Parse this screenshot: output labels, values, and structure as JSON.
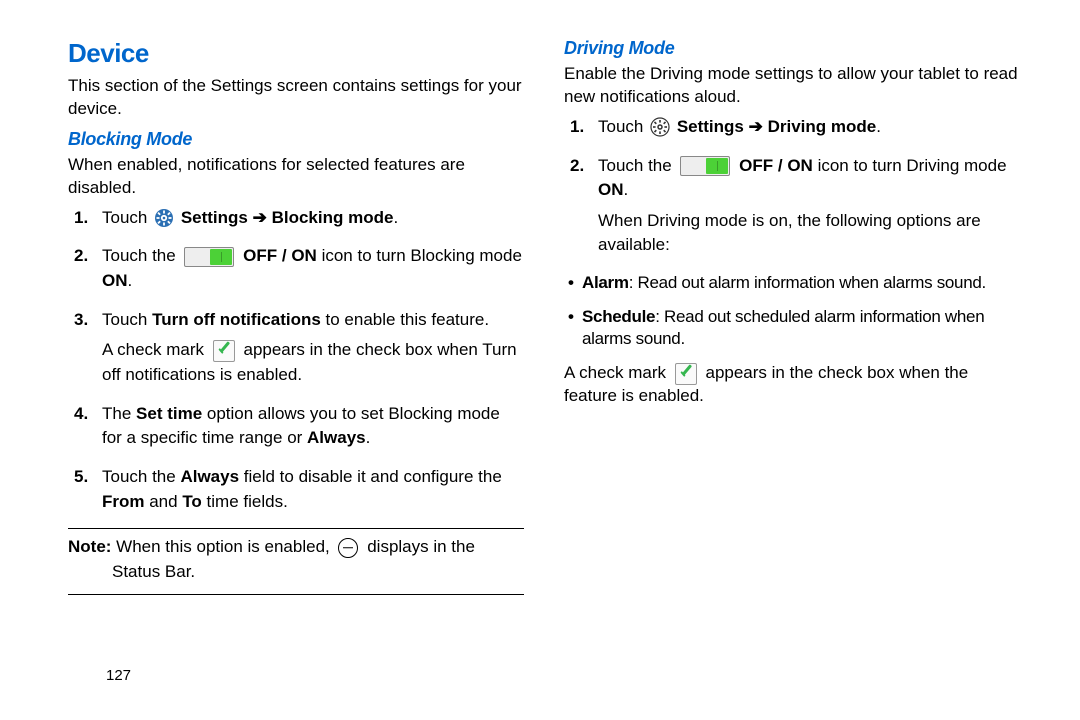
{
  "page_number": "127",
  "left": {
    "heading": "Device",
    "intro": "This section of the Settings screen contains settings for your device.",
    "section_title": "Blocking Mode",
    "section_desc": "When enabled, notifications for selected features are disabled.",
    "steps": {
      "s1_num": "1.",
      "s1_touch": "Touch ",
      "s1_settings": " Settings ",
      "s1_arrow": "➔",
      "s1_mode": " Blocking mode",
      "s1_period": ".",
      "s2_num": "2.",
      "s2_a": "Touch the ",
      "s2_offon": " OFF / ON",
      "s2_b": " icon to turn Blocking mode ",
      "s2_on": "ON",
      "s2_period": ".",
      "s3_num": "3.",
      "s3_a": "Touch ",
      "s3_b": "Turn off notifications",
      "s3_c": " to enable this feature.",
      "s3_sub_a": "A check mark ",
      "s3_sub_b": " appears in the check box when Turn off notifications is enabled.",
      "s4_num": "4.",
      "s4_a": "The ",
      "s4_b": "Set time",
      "s4_c": " option allows you to set Blocking mode for a specific time range or ",
      "s4_d": "Always",
      "s4_period": ".",
      "s5_num": "5.",
      "s5_a": "Touch the ",
      "s5_b": "Always",
      "s5_c": " field to disable it and configure the ",
      "s5_d": "From",
      "s5_e": " and ",
      "s5_f": "To",
      "s5_g": " time fields."
    },
    "note_label": "Note:",
    "note_a": " When this option is enabled, ",
    "note_b": " displays in the",
    "note_c": "Status Bar."
  },
  "right": {
    "section_title": "Driving Mode",
    "section_desc": "Enable the Driving mode settings to allow your tablet to read new notifications aloud.",
    "steps": {
      "s1_num": "1.",
      "s1_touch": "Touch ",
      "s1_settings": " Settings ",
      "s1_arrow": "➔",
      "s1_mode": " Driving mode",
      "s1_period": ".",
      "s2_num": "2.",
      "s2_a": "Touch the ",
      "s2_offon": " OFF / ON",
      "s2_b": " icon to turn Driving mode ",
      "s2_on": "ON",
      "s2_period": ".",
      "s2_sub": "When Driving mode is on, the following options are available:"
    },
    "bullets": {
      "b1_a": "Alarm",
      "b1_b": ": Read out alarm information when alarms sound.",
      "b2_a": "Schedule",
      "b2_b": ": Read out scheduled alarm information when alarms sound."
    },
    "closing_a": "A check mark ",
    "closing_b": " appears in the check box when the feature is enabled."
  }
}
